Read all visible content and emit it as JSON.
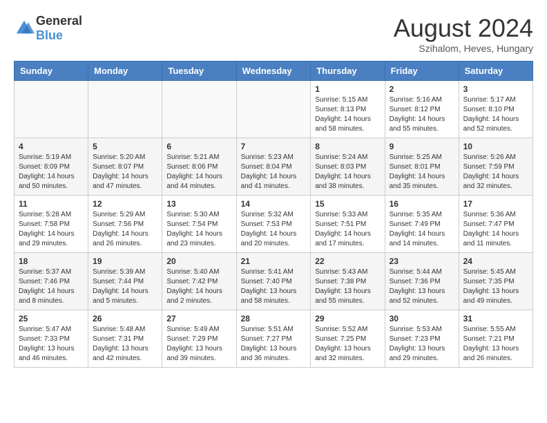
{
  "header": {
    "logo_general": "General",
    "logo_blue": "Blue",
    "month": "August 2024",
    "location": "Szihalom, Heves, Hungary"
  },
  "weekdays": [
    "Sunday",
    "Monday",
    "Tuesday",
    "Wednesday",
    "Thursday",
    "Friday",
    "Saturday"
  ],
  "weeks": [
    [
      {
        "day": "",
        "info": ""
      },
      {
        "day": "",
        "info": ""
      },
      {
        "day": "",
        "info": ""
      },
      {
        "day": "",
        "info": ""
      },
      {
        "day": "1",
        "info": "Sunrise: 5:15 AM\nSunset: 8:13 PM\nDaylight: 14 hours\nand 58 minutes."
      },
      {
        "day": "2",
        "info": "Sunrise: 5:16 AM\nSunset: 8:12 PM\nDaylight: 14 hours\nand 55 minutes."
      },
      {
        "day": "3",
        "info": "Sunrise: 5:17 AM\nSunset: 8:10 PM\nDaylight: 14 hours\nand 52 minutes."
      }
    ],
    [
      {
        "day": "4",
        "info": "Sunrise: 5:19 AM\nSunset: 8:09 PM\nDaylight: 14 hours\nand 50 minutes."
      },
      {
        "day": "5",
        "info": "Sunrise: 5:20 AM\nSunset: 8:07 PM\nDaylight: 14 hours\nand 47 minutes."
      },
      {
        "day": "6",
        "info": "Sunrise: 5:21 AM\nSunset: 8:06 PM\nDaylight: 14 hours\nand 44 minutes."
      },
      {
        "day": "7",
        "info": "Sunrise: 5:23 AM\nSunset: 8:04 PM\nDaylight: 14 hours\nand 41 minutes."
      },
      {
        "day": "8",
        "info": "Sunrise: 5:24 AM\nSunset: 8:03 PM\nDaylight: 14 hours\nand 38 minutes."
      },
      {
        "day": "9",
        "info": "Sunrise: 5:25 AM\nSunset: 8:01 PM\nDaylight: 14 hours\nand 35 minutes."
      },
      {
        "day": "10",
        "info": "Sunrise: 5:26 AM\nSunset: 7:59 PM\nDaylight: 14 hours\nand 32 minutes."
      }
    ],
    [
      {
        "day": "11",
        "info": "Sunrise: 5:28 AM\nSunset: 7:58 PM\nDaylight: 14 hours\nand 29 minutes."
      },
      {
        "day": "12",
        "info": "Sunrise: 5:29 AM\nSunset: 7:56 PM\nDaylight: 14 hours\nand 26 minutes."
      },
      {
        "day": "13",
        "info": "Sunrise: 5:30 AM\nSunset: 7:54 PM\nDaylight: 14 hours\nand 23 minutes."
      },
      {
        "day": "14",
        "info": "Sunrise: 5:32 AM\nSunset: 7:53 PM\nDaylight: 14 hours\nand 20 minutes."
      },
      {
        "day": "15",
        "info": "Sunrise: 5:33 AM\nSunset: 7:51 PM\nDaylight: 14 hours\nand 17 minutes."
      },
      {
        "day": "16",
        "info": "Sunrise: 5:35 AM\nSunset: 7:49 PM\nDaylight: 14 hours\nand 14 minutes."
      },
      {
        "day": "17",
        "info": "Sunrise: 5:36 AM\nSunset: 7:47 PM\nDaylight: 14 hours\nand 11 minutes."
      }
    ],
    [
      {
        "day": "18",
        "info": "Sunrise: 5:37 AM\nSunset: 7:46 PM\nDaylight: 14 hours\nand 8 minutes."
      },
      {
        "day": "19",
        "info": "Sunrise: 5:39 AM\nSunset: 7:44 PM\nDaylight: 14 hours\nand 5 minutes."
      },
      {
        "day": "20",
        "info": "Sunrise: 5:40 AM\nSunset: 7:42 PM\nDaylight: 14 hours\nand 2 minutes."
      },
      {
        "day": "21",
        "info": "Sunrise: 5:41 AM\nSunset: 7:40 PM\nDaylight: 13 hours\nand 58 minutes."
      },
      {
        "day": "22",
        "info": "Sunrise: 5:43 AM\nSunset: 7:38 PM\nDaylight: 13 hours\nand 55 minutes."
      },
      {
        "day": "23",
        "info": "Sunrise: 5:44 AM\nSunset: 7:36 PM\nDaylight: 13 hours\nand 52 minutes."
      },
      {
        "day": "24",
        "info": "Sunrise: 5:45 AM\nSunset: 7:35 PM\nDaylight: 13 hours\nand 49 minutes."
      }
    ],
    [
      {
        "day": "25",
        "info": "Sunrise: 5:47 AM\nSunset: 7:33 PM\nDaylight: 13 hours\nand 46 minutes."
      },
      {
        "day": "26",
        "info": "Sunrise: 5:48 AM\nSunset: 7:31 PM\nDaylight: 13 hours\nand 42 minutes."
      },
      {
        "day": "27",
        "info": "Sunrise: 5:49 AM\nSunset: 7:29 PM\nDaylight: 13 hours\nand 39 minutes."
      },
      {
        "day": "28",
        "info": "Sunrise: 5:51 AM\nSunset: 7:27 PM\nDaylight: 13 hours\nand 36 minutes."
      },
      {
        "day": "29",
        "info": "Sunrise: 5:52 AM\nSunset: 7:25 PM\nDaylight: 13 hours\nand 32 minutes."
      },
      {
        "day": "30",
        "info": "Sunrise: 5:53 AM\nSunset: 7:23 PM\nDaylight: 13 hours\nand 29 minutes."
      },
      {
        "day": "31",
        "info": "Sunrise: 5:55 AM\nSunset: 7:21 PM\nDaylight: 13 hours\nand 26 minutes."
      }
    ]
  ]
}
